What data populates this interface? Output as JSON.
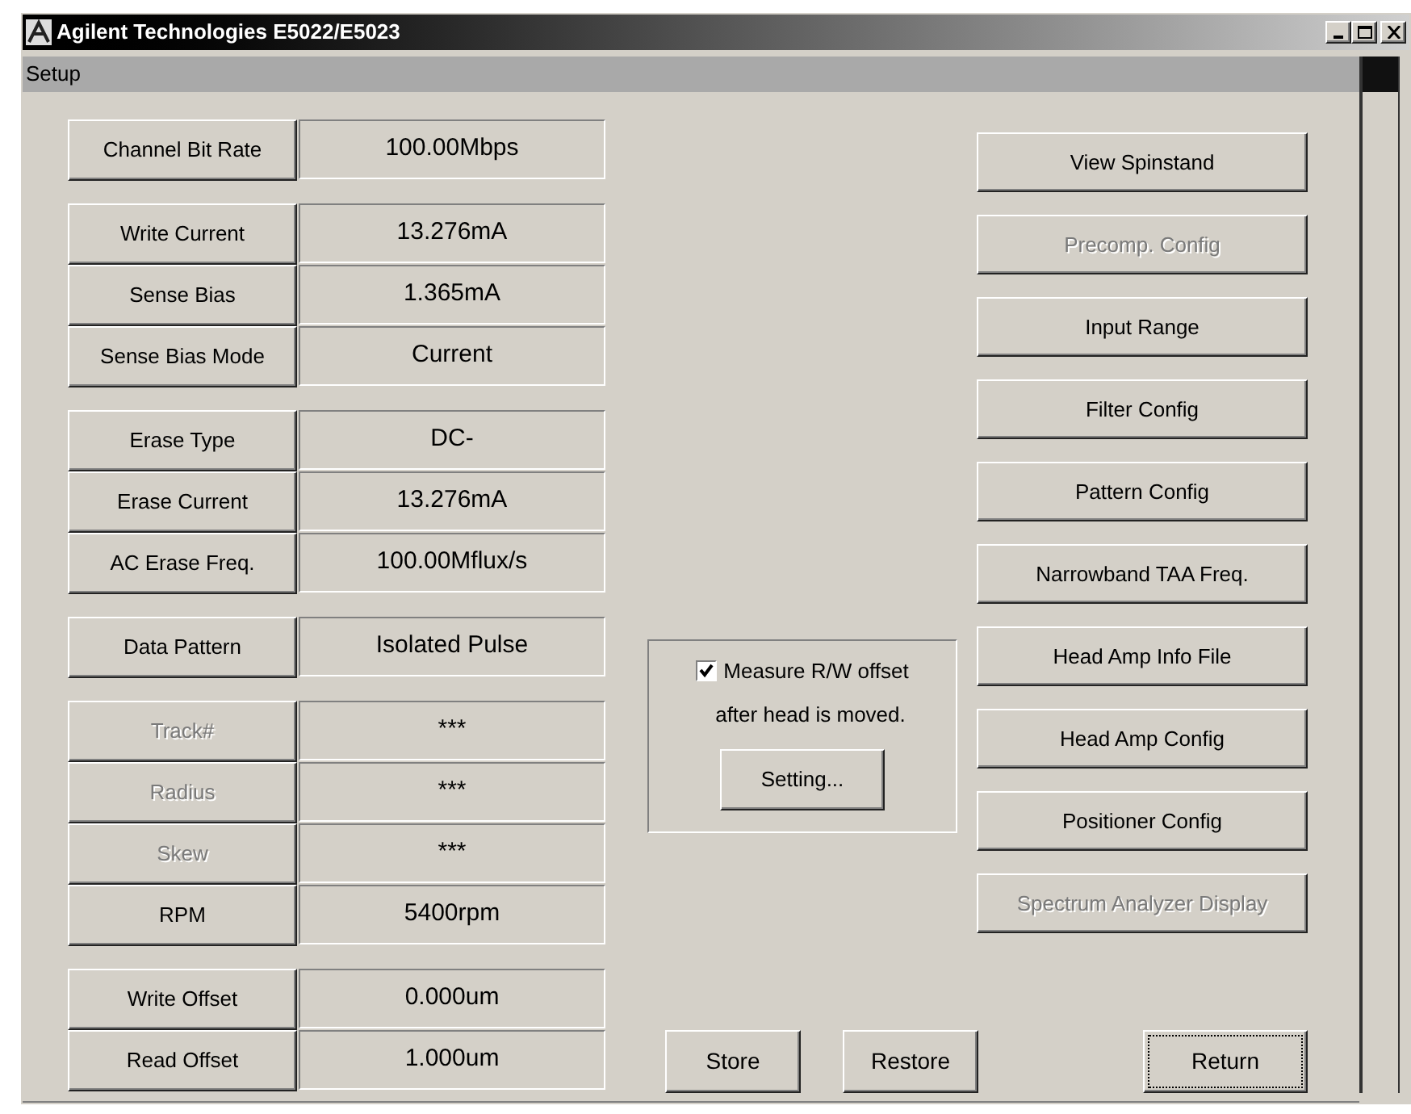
{
  "window": {
    "title": "Agilent Technologies E5022/E5023"
  },
  "menu_bar": {
    "label": "Setup"
  },
  "parameter_groups": [
    {
      "rows": [
        {
          "label": "Channel Bit Rate",
          "value": "100.00Mbps",
          "disabled": false
        }
      ]
    },
    {
      "rows": [
        {
          "label": "Write Current",
          "value": "13.276mA",
          "disabled": false
        },
        {
          "label": "Sense Bias",
          "value": "1.365mA",
          "disabled": false
        },
        {
          "label": "Sense Bias Mode",
          "value": "Current",
          "disabled": false
        }
      ]
    },
    {
      "rows": [
        {
          "label": "Erase Type",
          "value": "DC-",
          "disabled": false
        },
        {
          "label": "Erase Current",
          "value": "13.276mA",
          "disabled": false
        },
        {
          "label": "AC Erase Freq.",
          "value": "100.00Mflux/s",
          "disabled": false
        }
      ]
    },
    {
      "rows": [
        {
          "label": "Data Pattern",
          "value": "Isolated Pulse",
          "disabled": false
        }
      ]
    },
    {
      "rows": [
        {
          "label": "Track#",
          "value": "***",
          "disabled": true
        },
        {
          "label": "Radius",
          "value": "***",
          "disabled": true
        },
        {
          "label": "Skew",
          "value": "***",
          "disabled": true
        },
        {
          "label": "RPM",
          "value": "5400rpm",
          "disabled": false
        }
      ]
    },
    {
      "rows": [
        {
          "label": "Write Offset",
          "value": "0.000um",
          "disabled": false
        },
        {
          "label": "Read Offset",
          "value": "1.000um",
          "disabled": false
        }
      ]
    }
  ],
  "offset_box": {
    "checked": true,
    "label_line_1": "Measure R/W offset",
    "label_line_2": "after head is moved.",
    "button": "Setting..."
  },
  "side_buttons": [
    {
      "label": "View Spinstand",
      "disabled": false
    },
    {
      "label": "Precomp. Config",
      "disabled": true
    },
    {
      "label": "Input Range",
      "disabled": false
    },
    {
      "label": "Filter Config",
      "disabled": false
    },
    {
      "label": "Pattern Config",
      "disabled": false
    },
    {
      "label": "Narrowband TAA Freq.",
      "disabled": false
    },
    {
      "label": "Head Amp Info File",
      "disabled": false
    },
    {
      "label": "Head Amp Config",
      "disabled": false
    },
    {
      "label": "Positioner Config",
      "disabled": false
    },
    {
      "label": "Spectrum Analyzer Display",
      "disabled": true
    }
  ],
  "bottom_buttons": [
    {
      "label": "Store",
      "focused": false
    },
    {
      "label": "Restore",
      "focused": false
    },
    {
      "label": "Return",
      "focused": true
    }
  ]
}
